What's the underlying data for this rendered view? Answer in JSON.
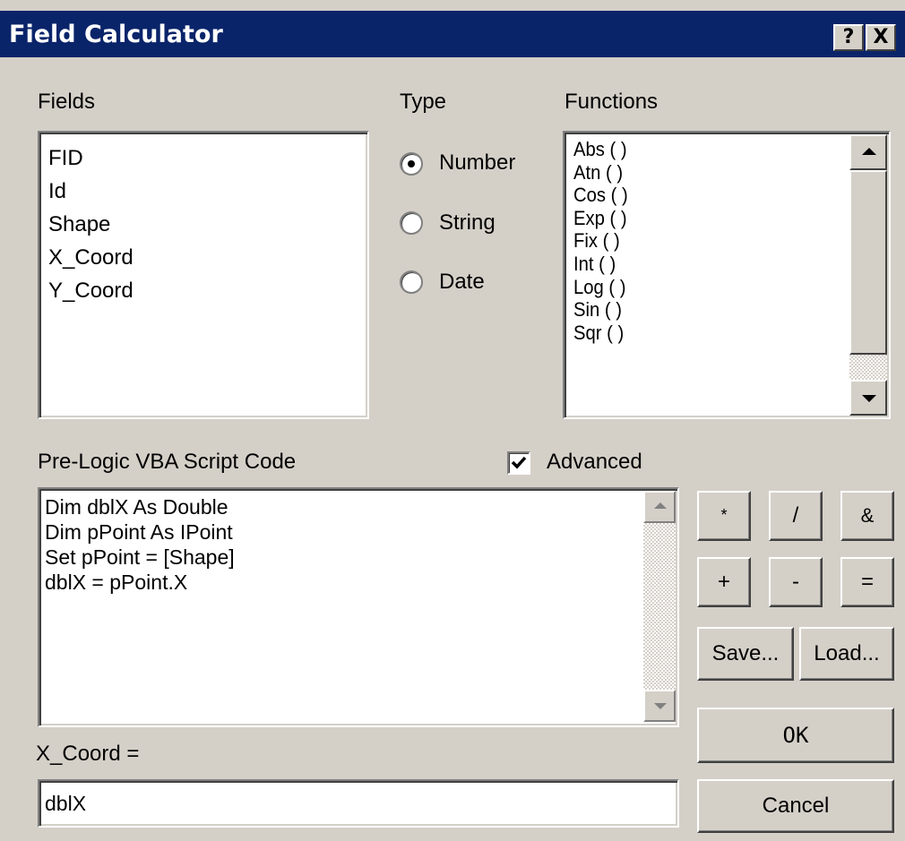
{
  "window": {
    "title": "Field Calculator",
    "help_label": "?",
    "close_label": "X",
    "titlebar_color": "#0a246a",
    "face_color": "#d4d0c8"
  },
  "fields": {
    "label": "Fields",
    "items": [
      "FID",
      "Id",
      "Shape",
      "X_Coord",
      "Y_Coord"
    ]
  },
  "type": {
    "label": "Type",
    "options": [
      "Number",
      "String",
      "Date"
    ],
    "selected": "Number"
  },
  "functions": {
    "label": "Functions",
    "items": [
      "Abs ( )",
      "Atn ( )",
      "Cos ( )",
      "Exp ( )",
      "Fix ( )",
      "Int ( )",
      "Log ( )",
      "Sin ( )",
      "Sqr ( )"
    ]
  },
  "prelogic": {
    "label": "Pre-Logic VBA Script Code",
    "advanced_label": "Advanced",
    "advanced_checked": true,
    "code_lines": [
      "Dim dblX As Double",
      "Dim pPoint As IPoint",
      "Set pPoint = [Shape]",
      "dblX = pPoint.X"
    ]
  },
  "operators": [
    "*",
    "/",
    "&",
    "+",
    "-",
    "="
  ],
  "buttons": {
    "save": "Save...",
    "load": "Load...",
    "ok": "OK",
    "cancel": "Cancel"
  },
  "expression": {
    "label": "X_Coord =",
    "value": "dblX"
  }
}
